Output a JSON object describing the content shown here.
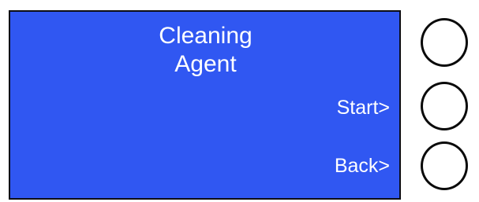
{
  "screen": {
    "title_line1": "Cleaning",
    "title_line2": "Agent",
    "background_color": "#3057f2",
    "text_color": "#ffffff"
  },
  "softkeys": [
    {
      "label": ""
    },
    {
      "label": "Start>"
    },
    {
      "label": "Back>"
    }
  ]
}
